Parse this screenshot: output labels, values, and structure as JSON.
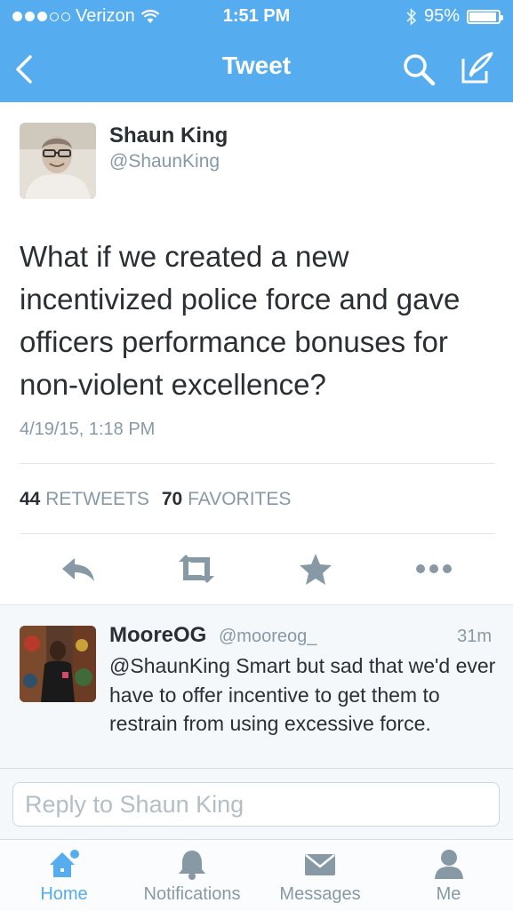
{
  "status": {
    "carrier": "Verizon",
    "time": "1:51 PM",
    "battery": "95%",
    "battery_level": 0.95
  },
  "nav": {
    "title": "Tweet"
  },
  "tweet": {
    "name": "Shaun King",
    "handle": "@ShaunKing",
    "text": "What if we created a new incentivized police force and gave officers performance bonuses for non-violent excellence?",
    "date": "4/19/15, 1:18 PM",
    "retweets_count": "44",
    "retweets_label": "RETWEETS",
    "favorites_count": "70",
    "favorites_label": "FAVORITES"
  },
  "reply": {
    "name": "MooreOG",
    "handle": "@mooreog_",
    "time": "31m",
    "text": "@ShaunKing Smart but sad that we'd ever have to offer incentive to get them to restrain from using excessive force."
  },
  "composer": {
    "placeholder": "Reply to Shaun King"
  },
  "tabs": [
    {
      "label": "Home",
      "icon": "home-icon",
      "active": true
    },
    {
      "label": "Notifications",
      "icon": "bell-icon"
    },
    {
      "label": "Messages",
      "icon": "envelope-icon"
    },
    {
      "label": "Me",
      "icon": "person-icon"
    }
  ],
  "colors": {
    "brand": "#55acee",
    "text": "#292f33",
    "muted": "#8899a6"
  }
}
